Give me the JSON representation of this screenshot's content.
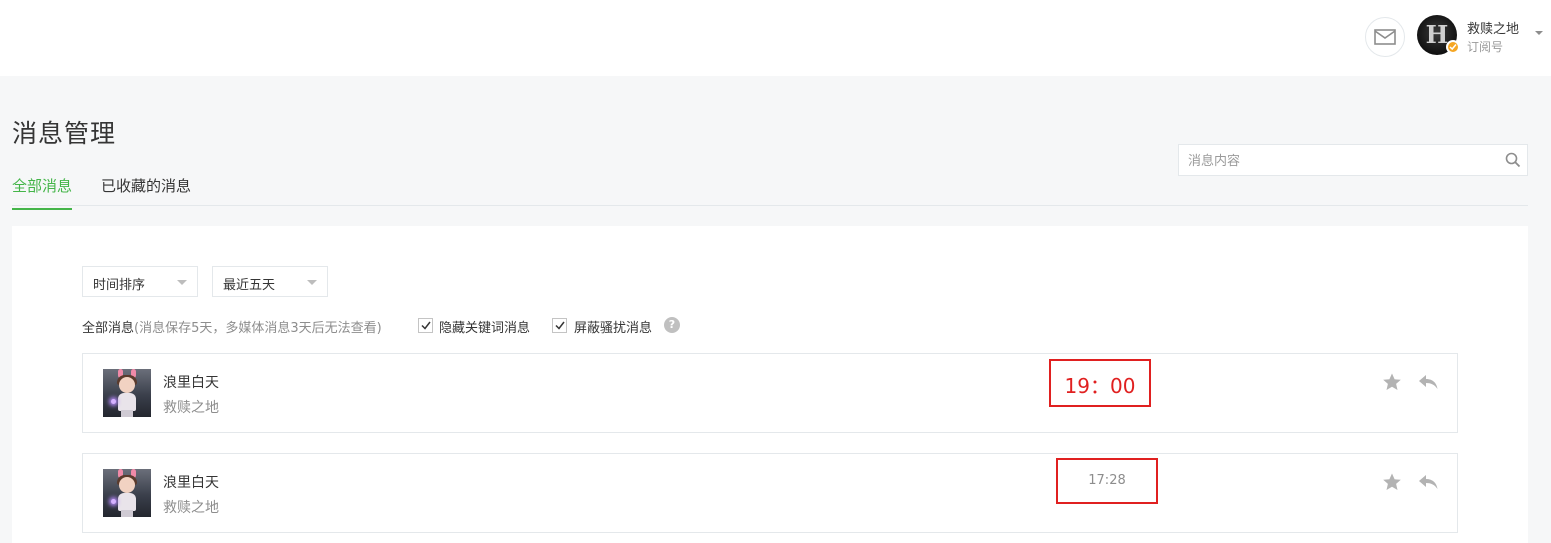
{
  "header": {
    "account_name": "救赎之地",
    "account_type": "订阅号",
    "avatar_letter": "H",
    "icons": [
      "mail-icon",
      "verified-icon",
      "caret-down-icon"
    ]
  },
  "page": {
    "title": "消息管理"
  },
  "tabs": [
    {
      "label": "全部消息",
      "active": true
    },
    {
      "label": "已收藏的消息",
      "active": false
    }
  ],
  "search": {
    "placeholder": "消息内容",
    "value": ""
  },
  "toolbar": {
    "sort_select": "时间排序",
    "range_select": "最近五天"
  },
  "filters": {
    "title": "全部消息",
    "note": "(消息保存5天，多媒体消息3天后无法查看)",
    "hide_keyword_label": "隐藏关键词消息",
    "hide_keyword_checked": true,
    "block_spam_label": "屏蔽骚扰消息",
    "block_spam_checked": true,
    "help_glyph": "?"
  },
  "messages": [
    {
      "nickname": "浪里白天",
      "content": "救赎之地",
      "time": "19：00",
      "starred": false
    },
    {
      "nickname": "浪里白天",
      "content": "救赎之地",
      "time": "17:28",
      "starred": false
    }
  ],
  "colors": {
    "accent": "#44b549",
    "highlight": "#e02020",
    "border": "#e4e8eb",
    "verified": "#f5a623"
  }
}
